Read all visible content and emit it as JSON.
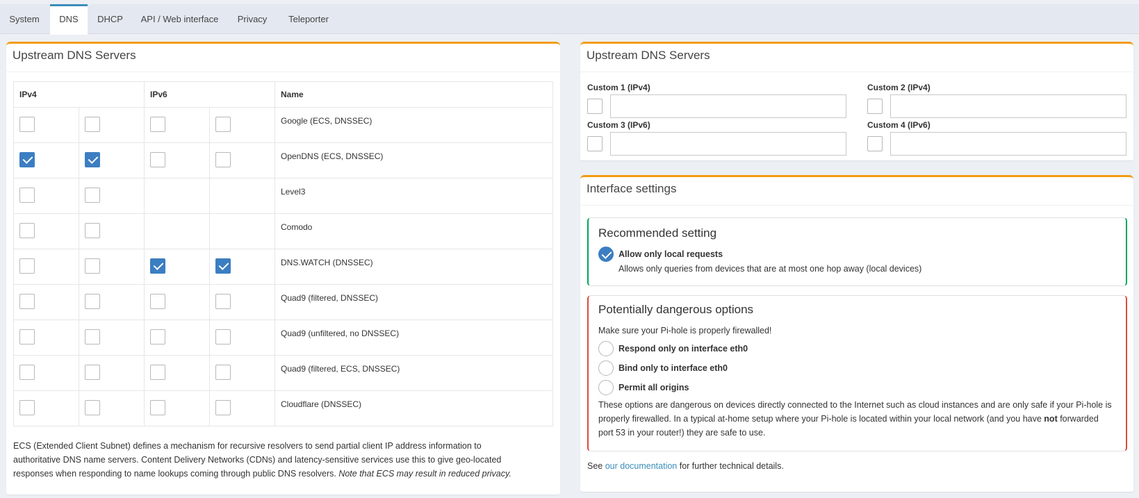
{
  "tabs": [
    "System",
    "DNS",
    "DHCP",
    "API / Web interface",
    "Privacy",
    "Teleporter"
  ],
  "active_tab": "DNS",
  "left_box": {
    "title": "Upstream DNS Servers",
    "headers": {
      "ipv4": "IPv4",
      "ipv6": "IPv6",
      "name": "Name"
    },
    "rows": [
      {
        "name": "Google (ECS, DNSSEC)",
        "ipv4": [
          false,
          false
        ],
        "ipv6": [
          false,
          false
        ]
      },
      {
        "name": "OpenDNS (ECS, DNSSEC)",
        "ipv4": [
          true,
          true
        ],
        "ipv6": [
          false,
          false
        ]
      },
      {
        "name": "Level3",
        "ipv4": [
          false,
          false
        ],
        "ipv6": null
      },
      {
        "name": "Comodo",
        "ipv4": [
          false,
          false
        ],
        "ipv6": null
      },
      {
        "name": "DNS.WATCH (DNSSEC)",
        "ipv4": [
          false,
          false
        ],
        "ipv6": [
          true,
          true
        ]
      },
      {
        "name": "Quad9 (filtered, DNSSEC)",
        "ipv4": [
          false,
          false
        ],
        "ipv6": [
          false,
          false
        ]
      },
      {
        "name": "Quad9 (unfiltered, no DNSSEC)",
        "ipv4": [
          false,
          false
        ],
        "ipv6": [
          false,
          false
        ]
      },
      {
        "name": "Quad9 (filtered, ECS, DNSSEC)",
        "ipv4": [
          false,
          false
        ],
        "ipv6": [
          false,
          false
        ]
      },
      {
        "name": "Cloudflare (DNSSEC)",
        "ipv4": [
          false,
          false
        ],
        "ipv6": [
          false,
          false
        ]
      }
    ],
    "note_main": "ECS (Extended Client Subnet) defines a mechanism for recursive resolvers to send partial client IP address information to authoritative DNS name servers. Content Delivery Networks (CDNs) and latency-sensitive services use this to give geo-located responses when responding to name lookups coming through public DNS resolvers. ",
    "note_italic": "Note that ECS may result in reduced privacy."
  },
  "custom_box": {
    "title": "Upstream DNS Servers",
    "custom1_label": "Custom 1 (IPv4)",
    "custom2_label": "Custom 2 (IPv4)",
    "custom3_label": "Custom 3 (IPv6)",
    "custom4_label": "Custom 4 (IPv6)",
    "custom1_value": "",
    "custom2_value": "",
    "custom3_value": "",
    "custom4_value": ""
  },
  "interface_box": {
    "title": "Interface settings",
    "recommended_title": "Recommended setting",
    "local_label": "Allow only local requests",
    "local_desc": "Allows only queries from devices that are at most one hop away (local devices)",
    "danger_title": "Potentially dangerous options",
    "danger_warning": "Make sure your Pi-hole is properly firewalled!",
    "opt_eth0_respond": "Respond only on interface eth0",
    "opt_eth0_bind": "Bind only to interface eth0",
    "opt_all": "Permit all origins",
    "danger_desc_1": "These options are dangerous on devices directly connected to the Internet such as cloud instances and are only safe if your Pi-hole is properly firewalled. In a typical at-home setup where your Pi-hole is located within your local network (and you have ",
    "danger_desc_bold": "not",
    "danger_desc_2": " forwarded port 53 in your router!) they are safe to use.",
    "see_prefix": "See ",
    "see_link": "our documentation",
    "see_suffix": " for further technical details."
  },
  "colors": {
    "accent": "#3c8dbc",
    "box_border": "#f39c12",
    "checked": "#3c7ec2",
    "green": "#00a65a",
    "red": "#dd4b39"
  }
}
